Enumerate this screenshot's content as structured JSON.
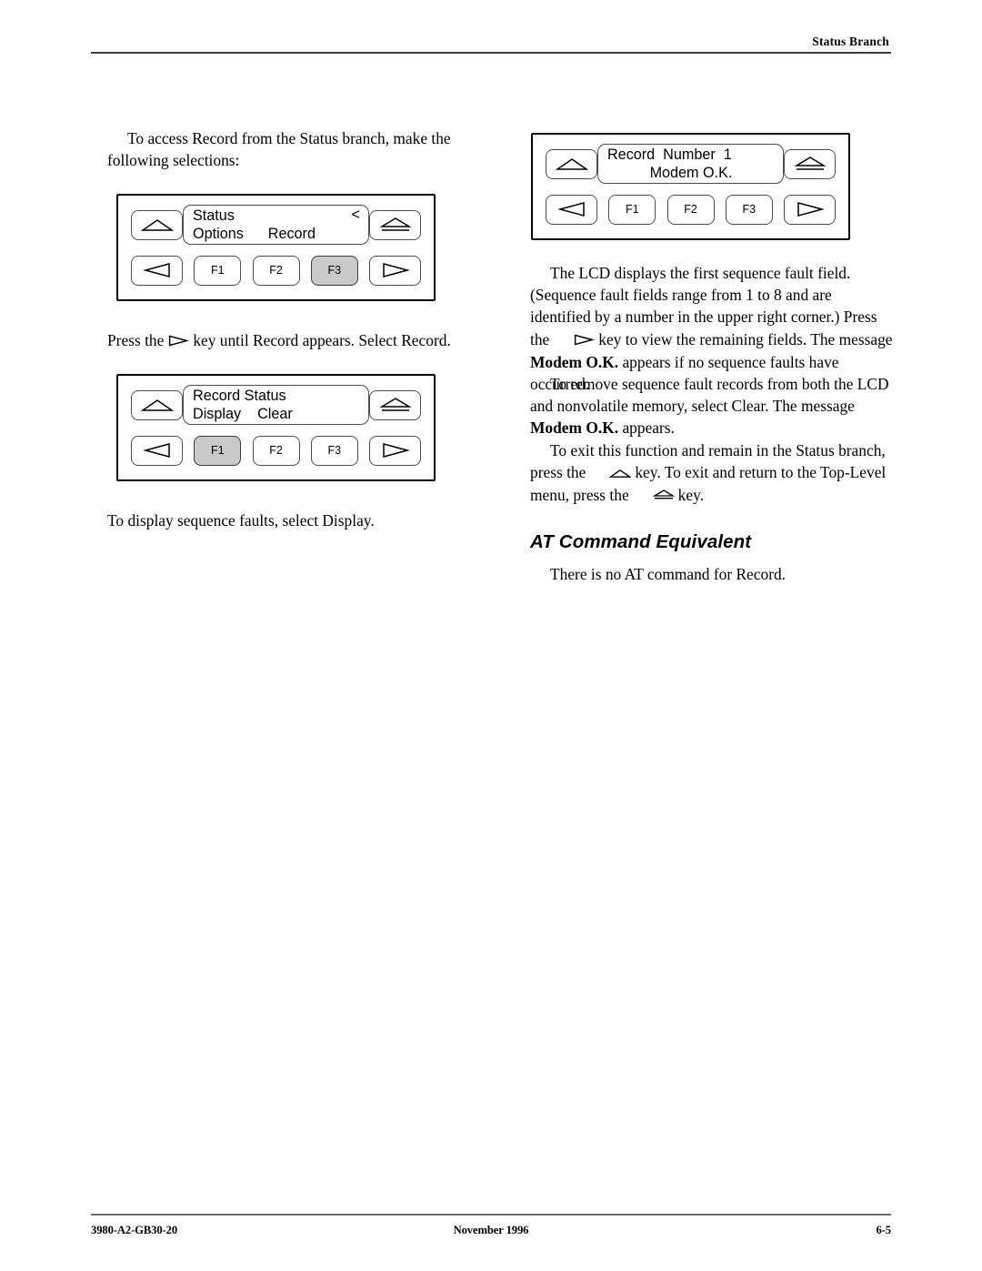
{
  "header": {
    "title": "Status Branch"
  },
  "footer": {
    "doc_number": "3980-A2-GB30-20",
    "date": "November 1996",
    "page_number": "6-5"
  },
  "left_column": {
    "para_1": "To access Record from the Status branch, make the following selections:",
    "para_2_before": "Press the",
    "para_2_after": "key until Record appears. Select Record.",
    "para_3": "To display sequence faults, select Display."
  },
  "right_column": {
    "para_1_a": "The LCD displays the first sequence fault field. (Sequence fault fields range from 1 to 8 and are identified by a number in the upper right corner.) Press the",
    "para_1_b": "key to view the remaining fields. The message",
    "para_1_bold": "Modem O.K.",
    "para_1_c": "appears if no sequence faults have occurred.",
    "para_2_a": "To remove sequence fault records from both the LCD and nonvolatile memory, select Clear. The message",
    "para_2_bold": "Modem O.K.",
    "para_2_b": "appears.",
    "para_3_a": "To exit this function and remain in the Status branch, press the",
    "para_3_b": "key. To exit and return to the Top-Level menu, press the",
    "para_3_c": "key.",
    "heading": "AT Command Equivalent",
    "para_4": "There is no AT command for Record."
  },
  "keypads": [
    {
      "id": "keypad-status-options-record",
      "lcd": {
        "line1": "Status",
        "line1_right": "<",
        "line2": "Options      Record",
        "line2_align": "left"
      },
      "keys": {
        "up": "up-arrow-key",
        "home": "top-level-key",
        "left": "left-arrow-key",
        "right": "right-arrow-key",
        "f1": "F1",
        "f2": "F2",
        "f3": "F3"
      },
      "highlighted": "F3"
    },
    {
      "id": "keypad-record-status",
      "lcd": {
        "line1": "Record Status",
        "line1_right": "",
        "line2": "Display    Clear",
        "line2_align": "left"
      },
      "keys": {
        "up": "up-arrow-key",
        "home": "top-level-key",
        "left": "left-arrow-key",
        "right": "right-arrow-key",
        "f1": "F1",
        "f2": "F2",
        "f3": "F3"
      },
      "highlighted": "F1"
    },
    {
      "id": "keypad-record-number",
      "lcd": {
        "line1": "Record  Number  1",
        "line1_right": "",
        "line2": "Modem O.K.",
        "line2_align": "center"
      },
      "keys": {
        "up": "up-arrow-key",
        "home": "top-level-key",
        "left": "left-arrow-key",
        "right": "right-arrow-key",
        "f1": "F1",
        "f2": "F2",
        "f3": "F3"
      },
      "highlighted": ""
    }
  ],
  "colors": {
    "key_highlight": "#c9c9c9",
    "rule": "#3a3a3a",
    "text": "#000000"
  }
}
